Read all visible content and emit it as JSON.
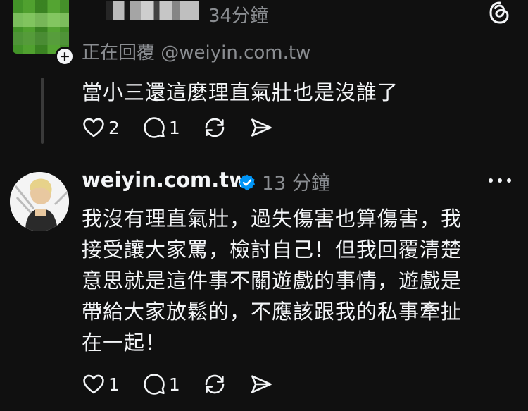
{
  "reply_post": {
    "time": "34分鐘",
    "reply_to": "正在回覆 @weiyin.com.tw",
    "text": "當小三還這麼理直氣壯也是沒誰了",
    "likes": "2",
    "comments": "1"
  },
  "main_post": {
    "author": "weiyin.com.tw",
    "time": "13 分鐘",
    "lines": [
      "我沒有理直氣壯，過失傷害也算傷害，我",
      "接受讓大家罵，檢討自己！但我回覆清楚",
      "意思就是這件事不關遊戲的事情，遊戲是",
      "帶給大家放鬆的，不應該跟我的私事牽扯",
      "在一起！"
    ],
    "likes": "1",
    "comments": "1"
  },
  "icons": {
    "threads": "threads-logo-icon",
    "like": "heart-icon",
    "comment": "comment-bubble-icon",
    "repost": "repost-icon",
    "share": "send-icon",
    "verified": "verified-badge-icon",
    "more": "more-dots-icon"
  },
  "colors": {
    "background": "#101010",
    "text": "#f3f5f7",
    "secondary": "#8a8d91",
    "verified": "#0095f6"
  }
}
